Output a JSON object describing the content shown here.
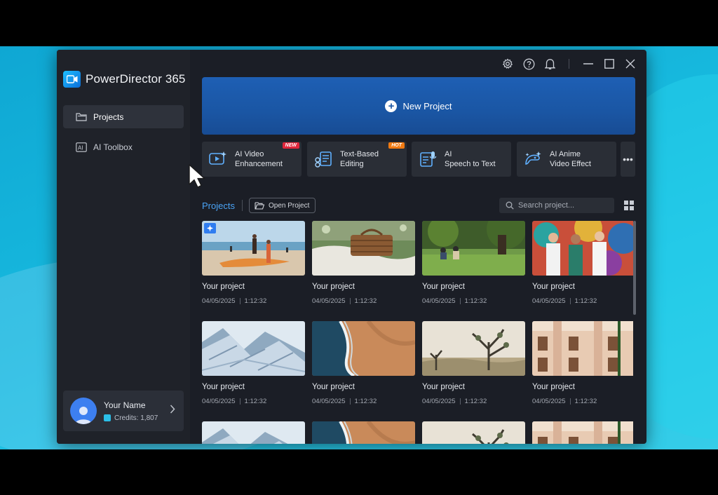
{
  "app": {
    "name": "PowerDirector 365"
  },
  "colors": {
    "accent": "#4aa3f5",
    "hero": "#1a56a4",
    "tag_new": "#e0263c",
    "tag_hot": "#f07a12"
  },
  "sidebar": {
    "items": [
      {
        "label": "Projects",
        "icon": "folder-icon",
        "active": true
      },
      {
        "label": "AI Toolbox",
        "icon": "ai-toolbox-icon",
        "active": false
      }
    ],
    "user": {
      "name": "Your Name",
      "credits": "Credits: 1,807"
    }
  },
  "titlebar": {
    "icons": [
      "settings-icon",
      "help-icon",
      "bell-icon",
      "minimize-icon",
      "maximize-icon",
      "close-icon"
    ]
  },
  "hero": {
    "label": "New Project"
  },
  "tools": [
    {
      "line1": "AI Video",
      "line2": "Enhancement",
      "tag": "NEW",
      "icon": "ai-video-enhancement-icon"
    },
    {
      "line1": "Text-Based",
      "line2": "Editing",
      "tag": "HOT",
      "icon": "text-based-editing-icon"
    },
    {
      "line1": "AI",
      "line2": "Speech to Text",
      "tag": "",
      "icon": "speech-to-text-icon"
    },
    {
      "line1": "AI Anime",
      "line2": "Video Effect",
      "tag": "",
      "icon": "anime-effect-icon"
    }
  ],
  "tools_more": "•••",
  "projects": {
    "title": "Projects",
    "open_label": "Open Project",
    "search_placeholder": "Search project...",
    "items": [
      {
        "name": "Your project",
        "date": "04/05/2025",
        "duration": "1:12:32",
        "thumb": "beach"
      },
      {
        "name": "Your project",
        "date": "04/05/2025",
        "duration": "1:12:32",
        "thumb": "picnic"
      },
      {
        "name": "Your project",
        "date": "04/05/2025",
        "duration": "1:12:32",
        "thumb": "park"
      },
      {
        "name": "Your project",
        "date": "04/05/2025",
        "duration": "1:12:32",
        "thumb": "friends"
      },
      {
        "name": "Your project",
        "date": "04/05/2025",
        "duration": "1:12:32",
        "thumb": "snow"
      },
      {
        "name": "Your project",
        "date": "04/05/2025",
        "duration": "1:12:32",
        "thumb": "coast"
      },
      {
        "name": "Your project",
        "date": "04/05/2025",
        "duration": "1:12:32",
        "thumb": "desert"
      },
      {
        "name": "Your project",
        "date": "04/05/2025",
        "duration": "1:12:32",
        "thumb": "building"
      },
      {
        "name": "",
        "date": "",
        "duration": "",
        "thumb": "snow"
      },
      {
        "name": "",
        "date": "",
        "duration": "",
        "thumb": "coast"
      },
      {
        "name": "",
        "date": "",
        "duration": "",
        "thumb": "desert"
      },
      {
        "name": "",
        "date": "",
        "duration": "",
        "thumb": "building"
      }
    ]
  }
}
